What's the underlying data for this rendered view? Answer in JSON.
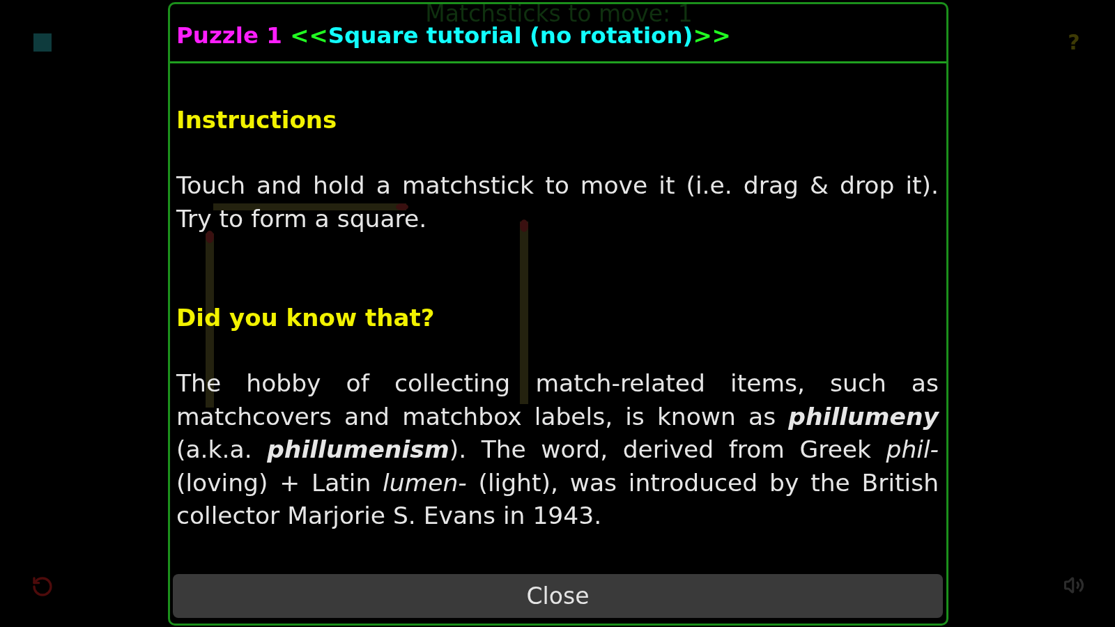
{
  "game": {
    "header": "Matchsticks to move: 1",
    "help": "?"
  },
  "dialog": {
    "title": [
      {
        "kind": "number",
        "text": "Puzzle 1"
      },
      {
        "kind": "bracket",
        "text": "<<"
      },
      {
        "kind": "name",
        "text": "Square tutorial (no rotation)"
      },
      {
        "kind": "bracket",
        "text": ">>"
      }
    ],
    "sections": [
      {
        "heading": "Instructions",
        "text": "Touch and hold a matchstick to move it (i.e. drag & drop it). Try to form a square."
      },
      {
        "heading": "Did you know that?",
        "text": "The hobby of collecting match-related items, such as matchcovers and matchbox labels, is known as **phillumeny** (a.k.a. **phillumenism**). The word, derived from Greek *phil-* (loving) + Latin *lumen-* (light), was introduced by the British collector Marjorie S. Evans in 1943."
      }
    ],
    "close_button": "Close"
  }
}
